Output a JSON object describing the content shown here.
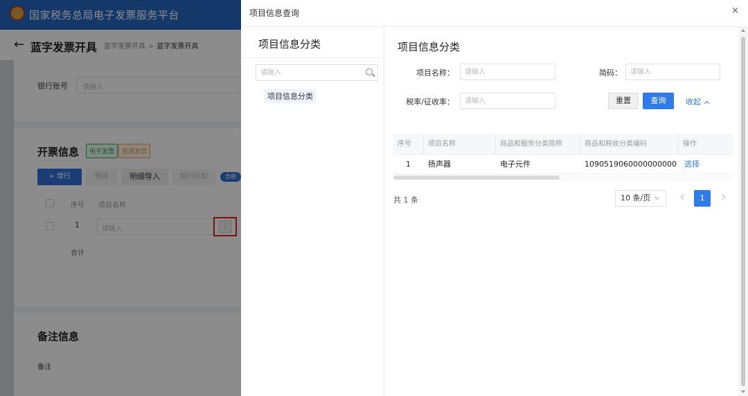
{
  "background": {
    "site_title": "国家税务总局电子发票服务平台",
    "page_title": "蓝字发票开具",
    "breadcrumb": [
      "蓝字发票开具",
      "蓝字发票开具"
    ],
    "bank_account_label": "银行账号",
    "input_placeholder": "请输入",
    "invoice_section_title": "开票信息",
    "tag_electronic": "电子发票",
    "tag_ordinary": "普通发票",
    "add_row_button": "+ 增行",
    "delete_button": "删除",
    "detail_import_button": "明细导入",
    "button_3": "整行折扣",
    "mini_tag": "含税",
    "col_seq": "序号",
    "col_item_name": "项目名称",
    "row_seq": "1",
    "total_label": "合计",
    "remark_section_title": "备注信息",
    "remark_label": "备注"
  },
  "dialog": {
    "title": "项目信息查询",
    "close": "×",
    "tree": {
      "title": "项目信息分类",
      "search_placeholder": "请输入",
      "node": "项目信息分类"
    },
    "panel_title": "项目信息分类",
    "form": {
      "item_name_label": "项目名称：",
      "item_name_placeholder": "请输入",
      "short_code_label": "简码：",
      "short_code_placeholder": "请输入",
      "tax_rate_label": "税率/征收率：",
      "tax_rate_placeholder": "请输入",
      "reset": "重置",
      "query": "查询",
      "collapse": "收起"
    },
    "table": {
      "headers": [
        "序号",
        "项目名称",
        "商品和服务分类简称",
        "商品和税收分类编码",
        "操作"
      ],
      "rows": [
        {
          "seq": "1",
          "name": "扬声器",
          "category": "电子元件",
          "code": "1090519060000000000",
          "action": "选择"
        }
      ]
    },
    "pagination": {
      "total": "共 1 条",
      "page_size": "10 条/页",
      "current_page": "1"
    }
  },
  "colors": {
    "brand_blue": "#2766c2",
    "primary": "#2f7be8",
    "highlight_red": "#e02020"
  }
}
